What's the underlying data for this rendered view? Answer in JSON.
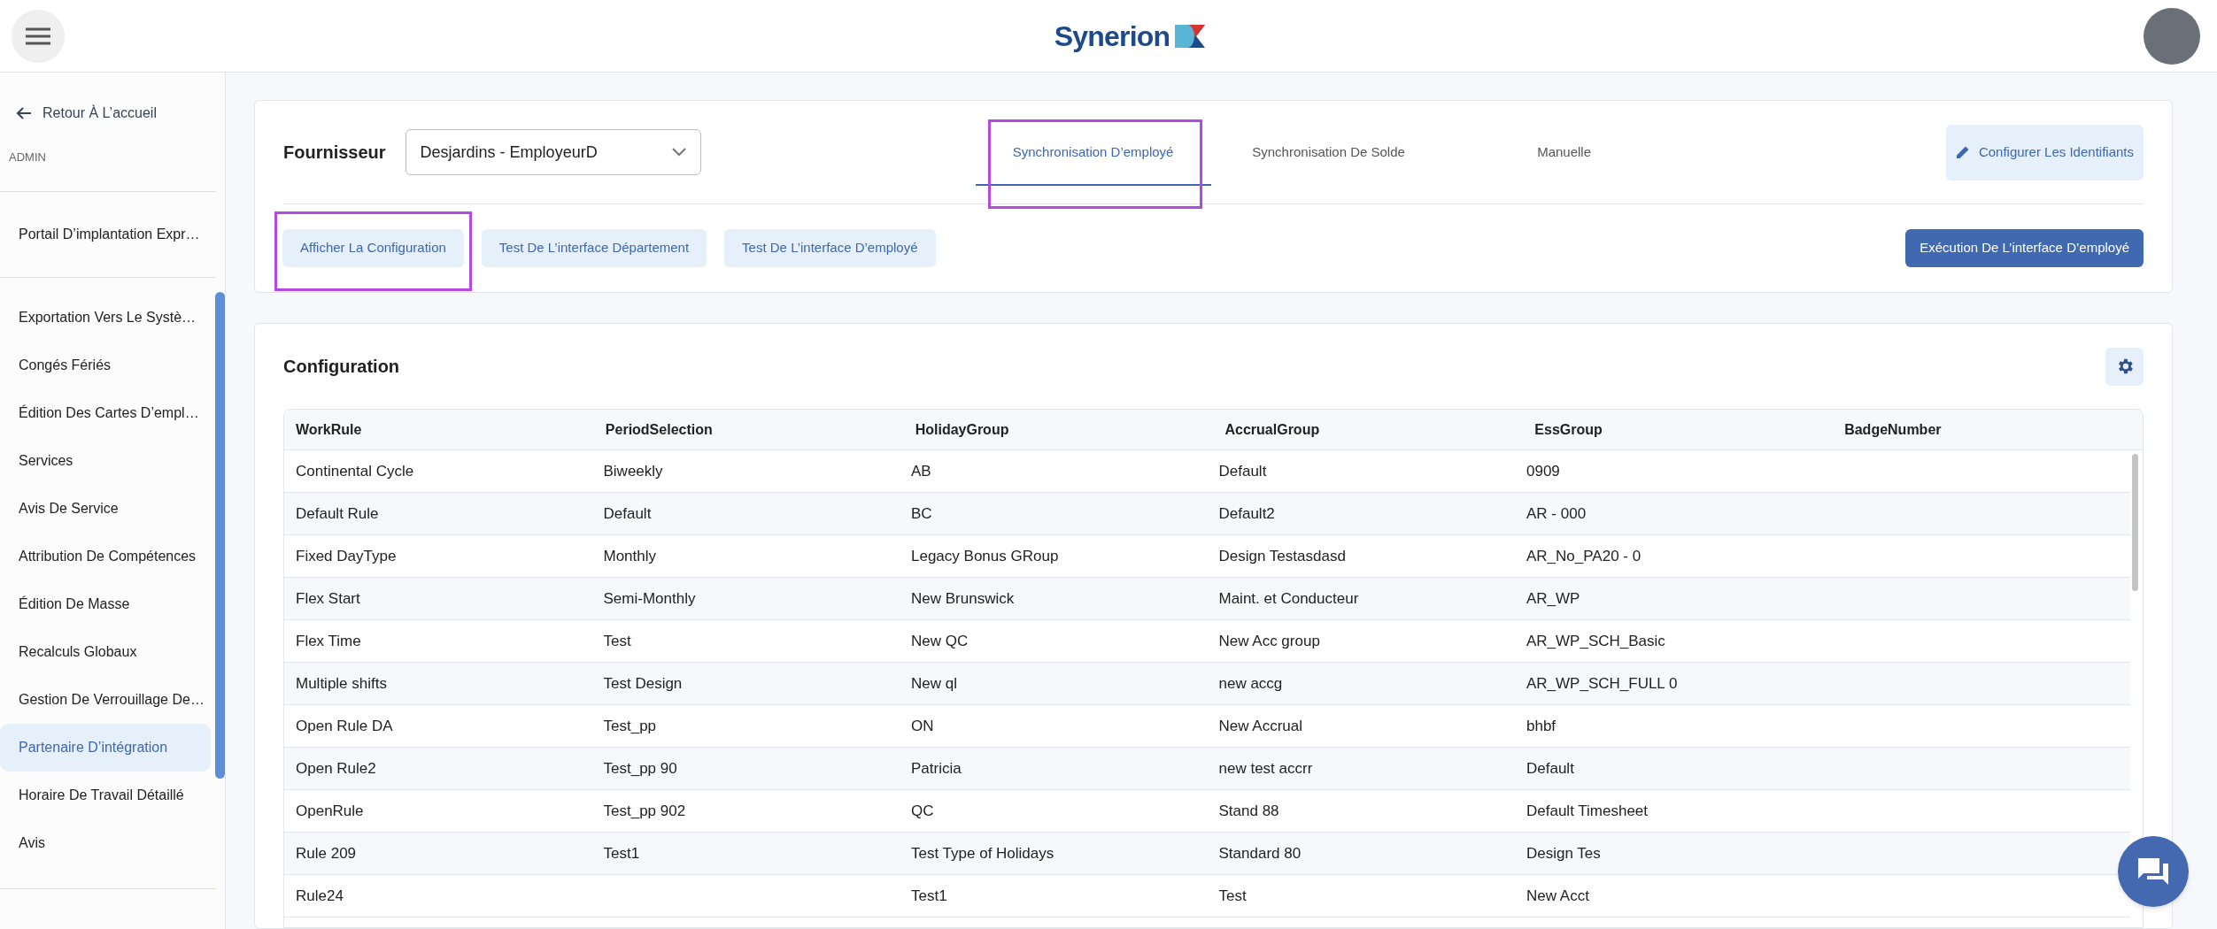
{
  "header": {
    "logo": "Synerion"
  },
  "sidebar": {
    "back": "Retour À L’accueil",
    "section": "ADMIN",
    "portal": "Portail D’implantation Expr…",
    "items": [
      {
        "label": "Exportation Vers Le Systè…",
        "selected": false
      },
      {
        "label": "Congés Fériés",
        "selected": false
      },
      {
        "label": "Édition Des Cartes D’empl…",
        "selected": false
      },
      {
        "label": "Services",
        "selected": false
      },
      {
        "label": "Avis De Service",
        "selected": false
      },
      {
        "label": "Attribution De Compétences",
        "selected": false
      },
      {
        "label": "Édition De Masse",
        "selected": false
      },
      {
        "label": "Recalculs Globaux",
        "selected": false
      },
      {
        "label": "Gestion De Verrouillage De…",
        "selected": false
      },
      {
        "label": "Partenaire D’intégration",
        "selected": true
      },
      {
        "label": "Horaire De Travail Détaillé",
        "selected": false
      },
      {
        "label": "Avis",
        "selected": false
      }
    ]
  },
  "provider": {
    "label": "Fournisseur",
    "value": "Desjardins - EmployeurD"
  },
  "tabs": [
    {
      "label": "Synchronisation D’employé",
      "selected": true,
      "highlighted": true
    },
    {
      "label": "Synchronisation De Solde",
      "selected": false,
      "highlighted": false
    },
    {
      "label": "Manuelle",
      "selected": false,
      "highlighted": false
    }
  ],
  "configure_button": "Configurer Les Identifiants",
  "actions": [
    {
      "label": "Afficher La Configuration",
      "highlighted": true
    },
    {
      "label": "Test De L’interface Département",
      "highlighted": false
    },
    {
      "label": "Test De L’interface D’employé",
      "highlighted": false
    }
  ],
  "run_button": "Exécution De L’interface D’employé",
  "configuration": {
    "title": "Configuration",
    "columns": [
      "WorkRule",
      "PeriodSelection",
      "HolidayGroup",
      "AccrualGroup",
      "EssGroup",
      "BadgeNumber"
    ],
    "rows": [
      [
        "Continental Cycle",
        "Biweekly",
        "AB",
        "Default",
        "0909",
        ""
      ],
      [
        "Default Rule",
        "Default",
        "BC",
        "Default2",
        "AR - 000",
        ""
      ],
      [
        "Fixed DayType",
        "Monthly",
        "Legacy Bonus GRoup",
        "Design Testasdasd",
        "AR_No_PA20 - 0",
        ""
      ],
      [
        "Flex Start",
        "Semi-Monthly",
        "New Brunswick",
        "Maint. et Conducteur",
        "AR_WP",
        ""
      ],
      [
        "Flex Time",
        "Test",
        "New QC",
        "New Acc group",
        "AR_WP_SCH_Basic",
        ""
      ],
      [
        "Multiple shifts",
        "Test Design",
        "New ql",
        "new accg",
        "AR_WP_SCH_FULL 0",
        ""
      ],
      [
        "Open Rule DA",
        "Test_pp",
        "ON",
        "New Accrual",
        "bhbf",
        ""
      ],
      [
        "Open Rule2",
        "Test_pp 90",
        "Patricia",
        "new test accrr",
        "Default",
        ""
      ],
      [
        "OpenRule",
        "Test_pp 902",
        "QC",
        "Stand 88",
        "Default Timesheet",
        ""
      ],
      [
        "Rule 209",
        "Test1",
        "Test Type of Holidays",
        "Standard 80",
        "Design Tes",
        ""
      ],
      [
        "Rule24",
        "",
        "Test1",
        "Test",
        "New Acct",
        ""
      ]
    ]
  }
}
